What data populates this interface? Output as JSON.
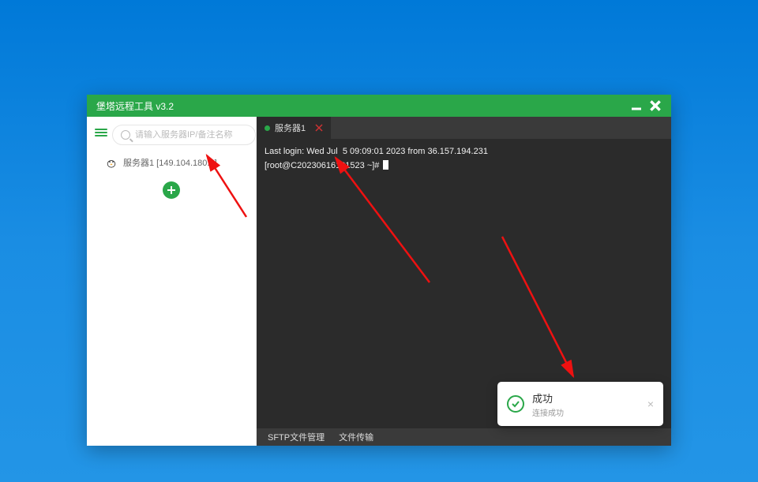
{
  "titlebar": {
    "title": "堡塔远程工具 v3.2"
  },
  "sidebar": {
    "search_placeholder": "请输入服务器IP/备注名称",
    "server_label": "服务器1 [149.104.180.8]"
  },
  "tabs": [
    {
      "label": "服务器1"
    }
  ],
  "terminal": {
    "line1": "Last login: Wed Jul  5 09:09:01 2023 from 36.157.194.231",
    "prompt": "[root@C20230616181523 ~]# "
  },
  "footer": {
    "item1": "SFTP文件管理",
    "item2": "文件传输"
  },
  "toast": {
    "title": "成功",
    "subtitle": "连接成功"
  }
}
